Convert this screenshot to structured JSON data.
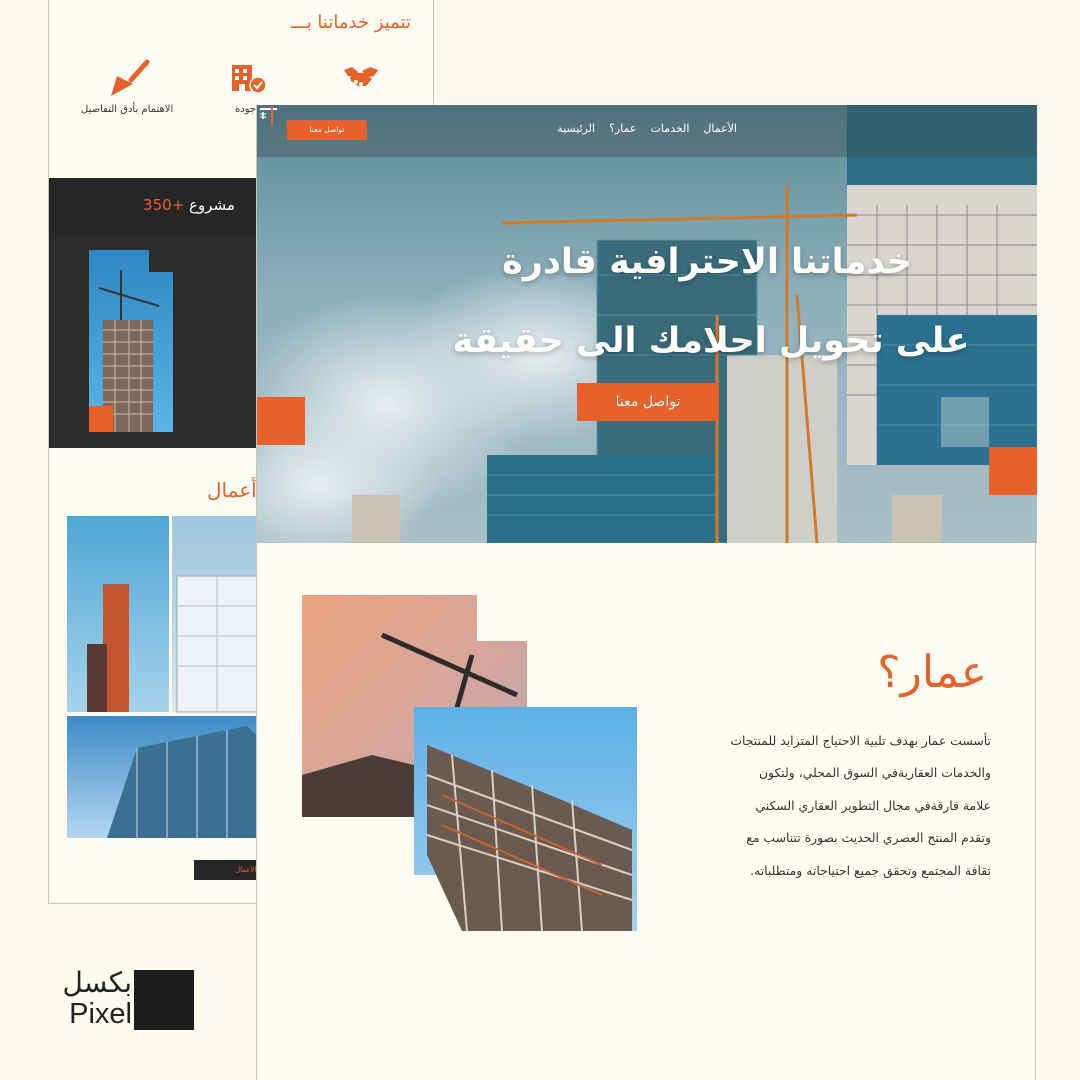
{
  "back_page": {
    "features_title": "تتميز خدماتنا بـــ",
    "features": [
      {
        "label": "",
        "icon": "handshake-icon"
      },
      {
        "label": "جودة",
        "icon": "building-check-icon"
      },
      {
        "label": "الاهتمام بأدق التفاصيل",
        "icon": "trowel-icon"
      }
    ],
    "projects_prefix": "مشروع",
    "projects_count": "+350",
    "works_title": "أعمال",
    "more_works_label": "د من الأعمال"
  },
  "main_page": {
    "nav": {
      "links": [
        "الرئيسية",
        "عمار؟",
        "الخدمات",
        "الأعمال"
      ],
      "cta": "تواصل معنا"
    },
    "hero": {
      "line1": "خدماتنا الاحترافية قادرة",
      "line2": "على تحويل احلامك الى حقيقة",
      "cta": "تواصل معنا"
    },
    "about": {
      "title": "عمار؟",
      "lines": [
        "تأسست عمار بهدف تلبية الاحتياج المتزايد للمنتجات",
        "والخدمات العقاريةفي السوق المحلي، ولتكون",
        "علامة فارقةفي مجال التطوير العقاري السكني",
        "وتقدم المنتج العصري الحديث بصورة تتناسب مع",
        "ثقافة المجتمع وتحقق جميع احتياجاته ومتطلباته."
      ]
    }
  },
  "brand": {
    "name_ar": "بكسل",
    "name_en": "Pixel"
  },
  "colors": {
    "accent": "#e8612a",
    "dark": "#262626",
    "background": "#fdfbf0",
    "beige_block": "#c9c3b6"
  }
}
